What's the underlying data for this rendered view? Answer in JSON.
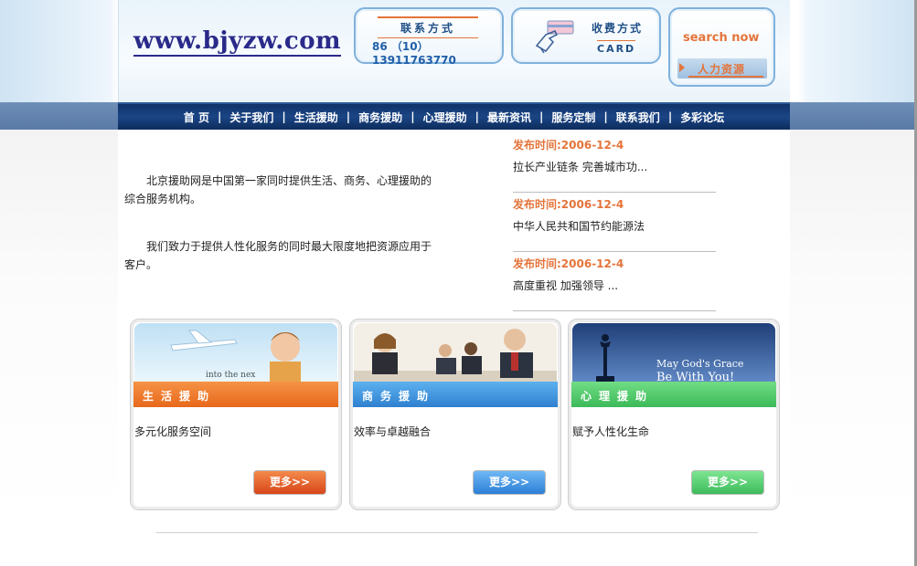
{
  "header": {
    "logo_text": "www.bjyzw.com",
    "contact": {
      "title": "联系方式",
      "number": "86 （10）13911763770"
    },
    "pay": {
      "title": "收费方式",
      "card": "CARD"
    },
    "search": {
      "label": "search now",
      "hr_label": "人力资源"
    }
  },
  "nav": {
    "items": [
      "首 页",
      "关于我们",
      "生活援助",
      "商务援助",
      "心理援助",
      "最新资讯",
      "服务定制",
      "联系我们",
      "多彩论坛"
    ],
    "separator": "|"
  },
  "intro": {
    "p1": "北京援助网是中国第一家同时提供生活、商务、心理援助的综合服务机构。",
    "p2": "我们致力于提供人性化服务的同时最大限度地把资源应用于客户。"
  },
  "news": [
    {
      "date": "发布时间:2006-12-4",
      "title": "拉长产业链条 完善城市功..."
    },
    {
      "date": "发布时间:2006-12-4",
      "title": "中华人民共和国节约能源法"
    },
    {
      "date": "发布时间:2006-12-4",
      "title": "高度重视 加强领导 ..."
    }
  ],
  "cards": [
    {
      "bar": "生活援助",
      "desc": "多元化服务空间",
      "more": "更多>>",
      "photo_caption": "into the nex"
    },
    {
      "bar": "商务援助",
      "desc": "效率与卓越融合",
      "more": "更多>>"
    },
    {
      "bar": "心理援助",
      "desc": "赋予人性化生命",
      "more": "更多>>",
      "photo_caption_1": "May God's Grace",
      "photo_caption_2": "Be With You!"
    }
  ],
  "colors": {
    "nav_bg": "#1b4585",
    "accent_orange": "#e4743a",
    "logo_blue": "#2a2a8a",
    "bar_orange": "#e8681b",
    "bar_blue": "#2e80cf",
    "bar_green": "#3cba59"
  }
}
